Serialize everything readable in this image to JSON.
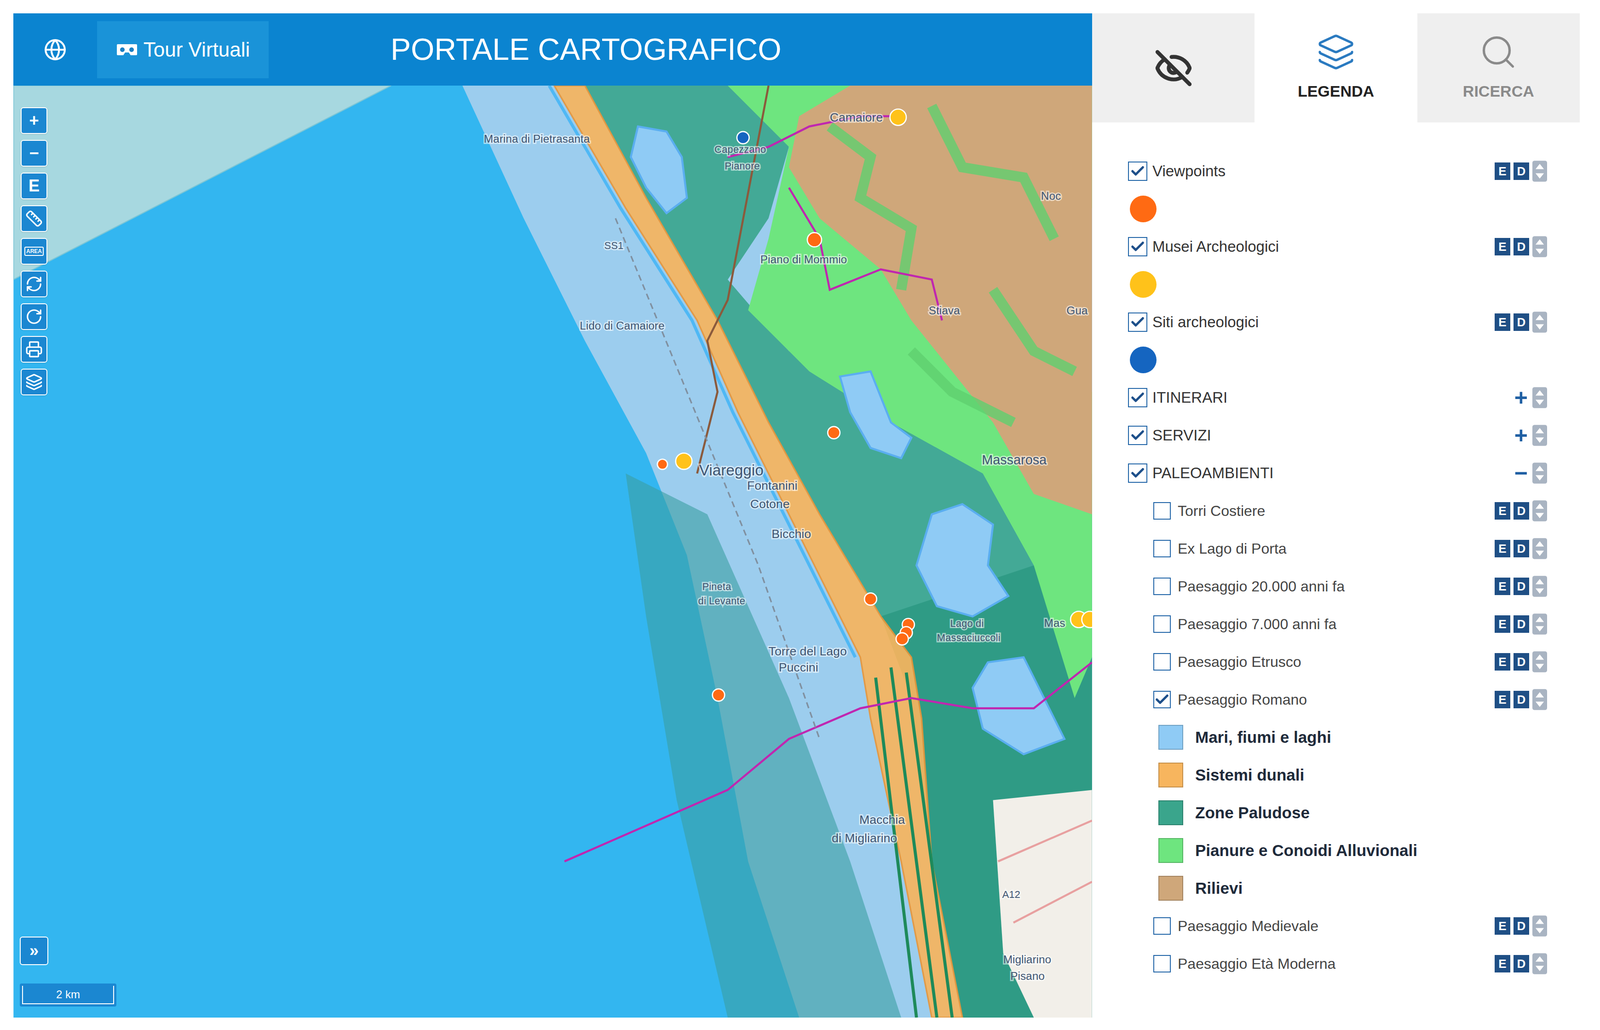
{
  "header": {
    "tour_button": "Tour Virtuali",
    "title": "PORTALE CARTOGRAFICO"
  },
  "toolbar": [
    {
      "kind": "text",
      "label": "+"
    },
    {
      "kind": "text",
      "label": "−"
    },
    {
      "kind": "text",
      "label": "E"
    },
    {
      "kind": "ruler"
    },
    {
      "kind": "area",
      "label": "AREA"
    },
    {
      "kind": "refresh"
    },
    {
      "kind": "redo"
    },
    {
      "kind": "print"
    },
    {
      "kind": "layers"
    }
  ],
  "map": {
    "labels": [
      "Marina di Pietrasanta",
      "Capezzano",
      "Pianore",
      "Camaiore",
      "Piano di Mommio",
      "Stiava",
      "Noc",
      "SS1",
      "Lido di Camaiore",
      "Viareggio",
      "Massarosa",
      "Fontanini",
      "Cotone",
      "Bicchio",
      "Pineta",
      "di Levante",
      "Torre del Lago",
      "Puccini",
      "Lago di",
      "Massaciuccoli",
      "Macchia",
      "di Migliarino",
      "Migliarino",
      "Pisano",
      "A12",
      "Gua",
      "Mas"
    ],
    "pins": [
      {
        "color": "#1565c0"
      },
      {
        "color": "#ffc21a"
      },
      {
        "color": "#ff6a13"
      },
      {
        "color": "#ff6a13"
      },
      {
        "color": "#ff6a13"
      },
      {
        "color": "#ffc21a"
      },
      {
        "color": "#ff6a13"
      },
      {
        "color": "#ff6a13"
      },
      {
        "color": "#ff6a13"
      },
      {
        "color": "#ff6a13"
      },
      {
        "color": "#ff6a13"
      },
      {
        "color": "#ffc21a"
      },
      {
        "color": "#ffc21a"
      }
    ],
    "expand_button": "»",
    "scale": "2 km"
  },
  "panel_tabs": [
    {
      "kind": "eye",
      "label": "",
      "selected": false
    },
    {
      "kind": "layers",
      "label": "LEGENDA",
      "selected": true
    },
    {
      "kind": "search",
      "label": "RICERCA",
      "selected": false
    }
  ],
  "legend": [
    {
      "kind": "layer",
      "label": "Viewpoints",
      "checked": true,
      "buttons": [
        "E",
        "D"
      ]
    },
    {
      "kind": "symbol",
      "color": "#ff6a13"
    },
    {
      "kind": "layer",
      "label": "Musei Archeologici",
      "checked": true,
      "buttons": [
        "E",
        "D"
      ]
    },
    {
      "kind": "symbol",
      "color": "#ffc21a"
    },
    {
      "kind": "layer",
      "label": "Siti archeologici",
      "checked": true,
      "buttons": [
        "E",
        "D"
      ]
    },
    {
      "kind": "symbol",
      "color": "#1565c0"
    },
    {
      "kind": "group",
      "label": "ITINERARI",
      "checked": true,
      "toggle": "+"
    },
    {
      "kind": "group",
      "label": "SERVIZI",
      "checked": true,
      "toggle": "+"
    },
    {
      "kind": "group",
      "label": "PALEOAMBIENTI",
      "checked": true,
      "toggle": "−"
    },
    {
      "kind": "sublayer",
      "label": "Torri Costiere",
      "checked": false,
      "buttons": [
        "E",
        "D"
      ]
    },
    {
      "kind": "sublayer",
      "label": "Ex Lago di Porta",
      "checked": false,
      "buttons": [
        "E",
        "D"
      ]
    },
    {
      "kind": "sublayer",
      "label": "Paesaggio 20.000 anni fa",
      "checked": false,
      "buttons": [
        "E",
        "D"
      ]
    },
    {
      "kind": "sublayer",
      "label": "Paesaggio 7.000 anni fa",
      "checked": false,
      "buttons": [
        "E",
        "D"
      ]
    },
    {
      "kind": "sublayer",
      "label": "Paesaggio Etrusco",
      "checked": false,
      "buttons": [
        "E",
        "D"
      ]
    },
    {
      "kind": "sublayer",
      "label": "Paesaggio Romano",
      "checked": true,
      "buttons": [
        "E",
        "D"
      ]
    },
    {
      "kind": "swatch",
      "label": "Mari, fiumi e laghi",
      "color": "#8fcbf5"
    },
    {
      "kind": "swatch",
      "label": "Sistemi dunali",
      "color": "#f7b55e"
    },
    {
      "kind": "swatch",
      "label": "Zone Paludose",
      "color": "#3aa58c"
    },
    {
      "kind": "swatch",
      "label": "Pianure e Conoidi Alluvionali",
      "color": "#6ee57f"
    },
    {
      "kind": "swatch",
      "label": "Rilievi",
      "color": "#cfa77a"
    },
    {
      "kind": "sublayer",
      "label": "Paesaggio Medievale",
      "checked": false,
      "buttons": [
        "E",
        "D"
      ]
    },
    {
      "kind": "sublayer",
      "label": "Paesaggio Età Moderna",
      "checked": false,
      "buttons": [
        "E",
        "D"
      ]
    }
  ]
}
